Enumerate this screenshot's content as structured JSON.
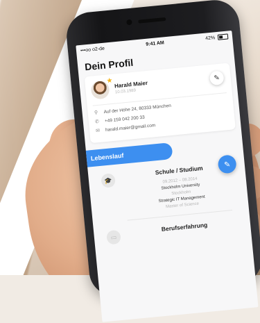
{
  "status": {
    "carrier": "•••oo o2-de",
    "wifi_icon": "wifi-icon",
    "time": "9:41 AM",
    "battery": "42%"
  },
  "profile": {
    "title": "Dein Profil",
    "name": "Harald Maier",
    "dob": "10.03.1989",
    "address": "Auf der Höhe 24, 80333 München",
    "phone": "+49 159 042 200 33",
    "email": "harald.maier@gmail.com"
  },
  "lebenslauf": {
    "label": "Lebenslauf"
  },
  "education": {
    "title": "Schule / Studium",
    "period": "09.2012 – 08.2014",
    "school": "Stockholm University",
    "city": "Stockholm",
    "program": "Strategic IT Management",
    "degree": "Master of Science"
  },
  "career": {
    "title": "Berufserfahrung"
  },
  "colors": {
    "accent": "#3d8ff0",
    "star": "#f4b41a"
  }
}
